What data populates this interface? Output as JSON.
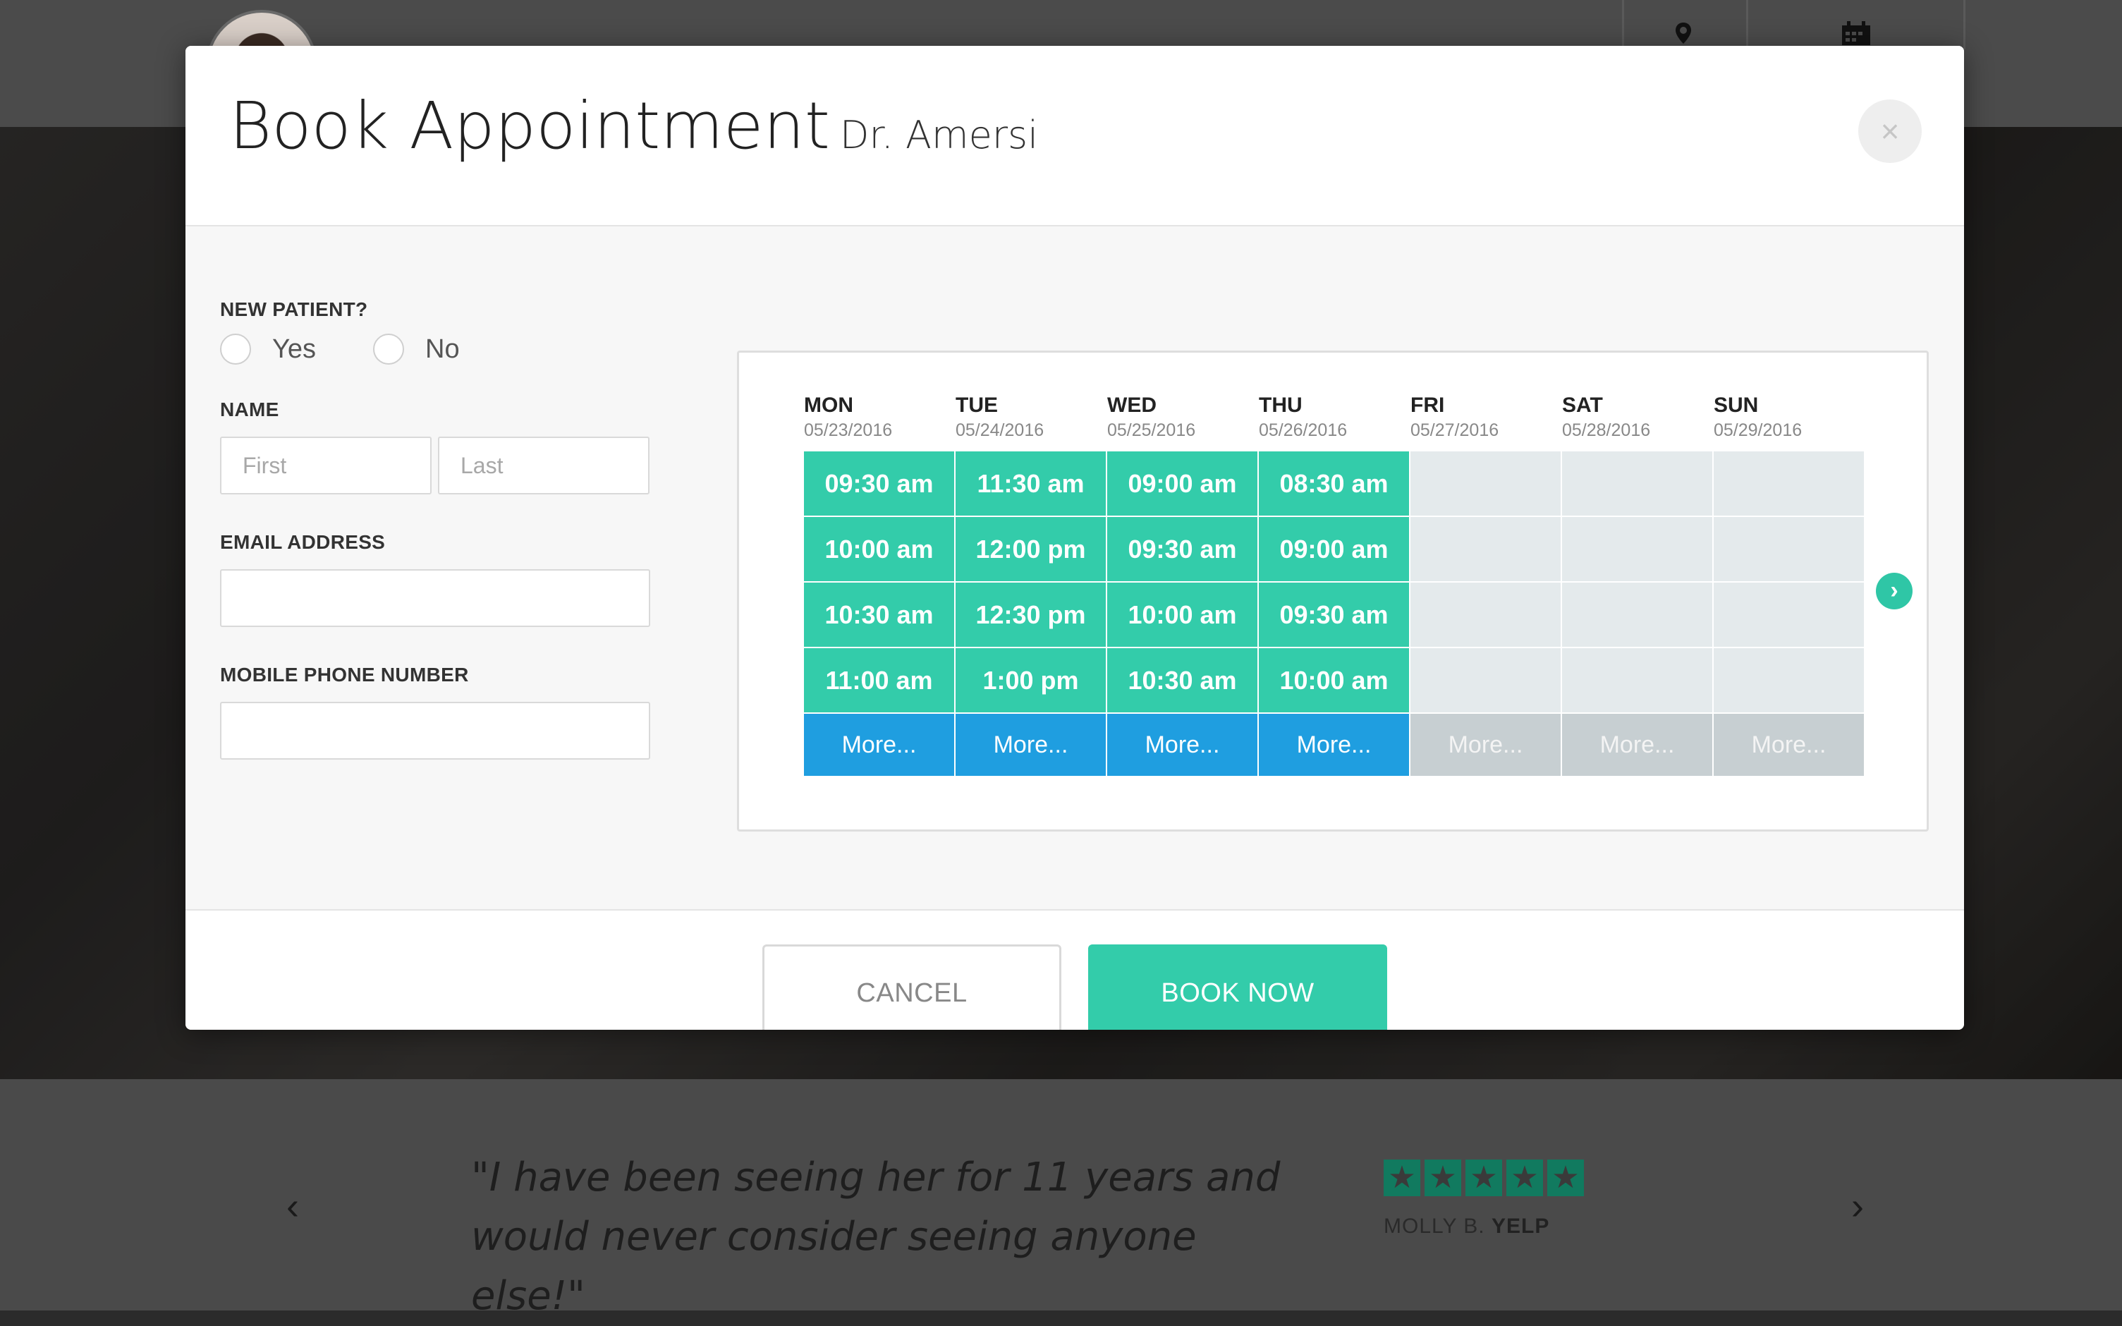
{
  "background": {
    "testimonial": {
      "quote": "\"I have been seeing her for 11 years and would never consider seeing anyone else!\"",
      "stars": 5,
      "reviewer_name": "MOLLY B.",
      "reviewer_source": "YELP"
    }
  },
  "modal": {
    "title": "Book Appointment",
    "subtitle": "Dr. Amersi",
    "close_label": "×",
    "form": {
      "new_patient_label": "NEW PATIENT?",
      "yes_label": "Yes",
      "no_label": "No",
      "name_label": "NAME",
      "first_placeholder": "First",
      "last_placeholder": "Last",
      "email_label": "EMAIL ADDRESS",
      "phone_label": "MOBILE PHONE NUMBER"
    },
    "calendar": {
      "next_label": "›",
      "days": [
        {
          "name": "MON",
          "date": "05/23/2016",
          "slots": [
            "09:30 am",
            "10:00 am",
            "10:30 am",
            "11:00 am"
          ],
          "more": "More...",
          "available": true
        },
        {
          "name": "TUE",
          "date": "05/24/2016",
          "slots": [
            "11:30 am",
            "12:00 pm",
            "12:30 pm",
            "1:00 pm"
          ],
          "more": "More...",
          "available": true
        },
        {
          "name": "WED",
          "date": "05/25/2016",
          "slots": [
            "09:00 am",
            "09:30 am",
            "10:00 am",
            "10:30 am"
          ],
          "more": "More...",
          "available": true
        },
        {
          "name": "THU",
          "date": "05/26/2016",
          "slots": [
            "08:30 am",
            "09:00 am",
            "09:30 am",
            "10:00 am"
          ],
          "more": "More...",
          "available": true
        },
        {
          "name": "FRI",
          "date": "05/27/2016",
          "slots": [],
          "more": "More...",
          "available": false
        },
        {
          "name": "SAT",
          "date": "05/28/2016",
          "slots": [],
          "more": "More...",
          "available": false
        },
        {
          "name": "SUN",
          "date": "05/29/2016",
          "slots": [],
          "more": "More...",
          "available": false
        }
      ]
    },
    "footer": {
      "cancel_label": "CANCEL",
      "book_label": "BOOK NOW"
    }
  },
  "colors": {
    "slot": "#33ccaa",
    "more_active": "#1f9ee0",
    "more_disabled": "#c7cfd2",
    "slot_empty": "#e4eaec"
  }
}
